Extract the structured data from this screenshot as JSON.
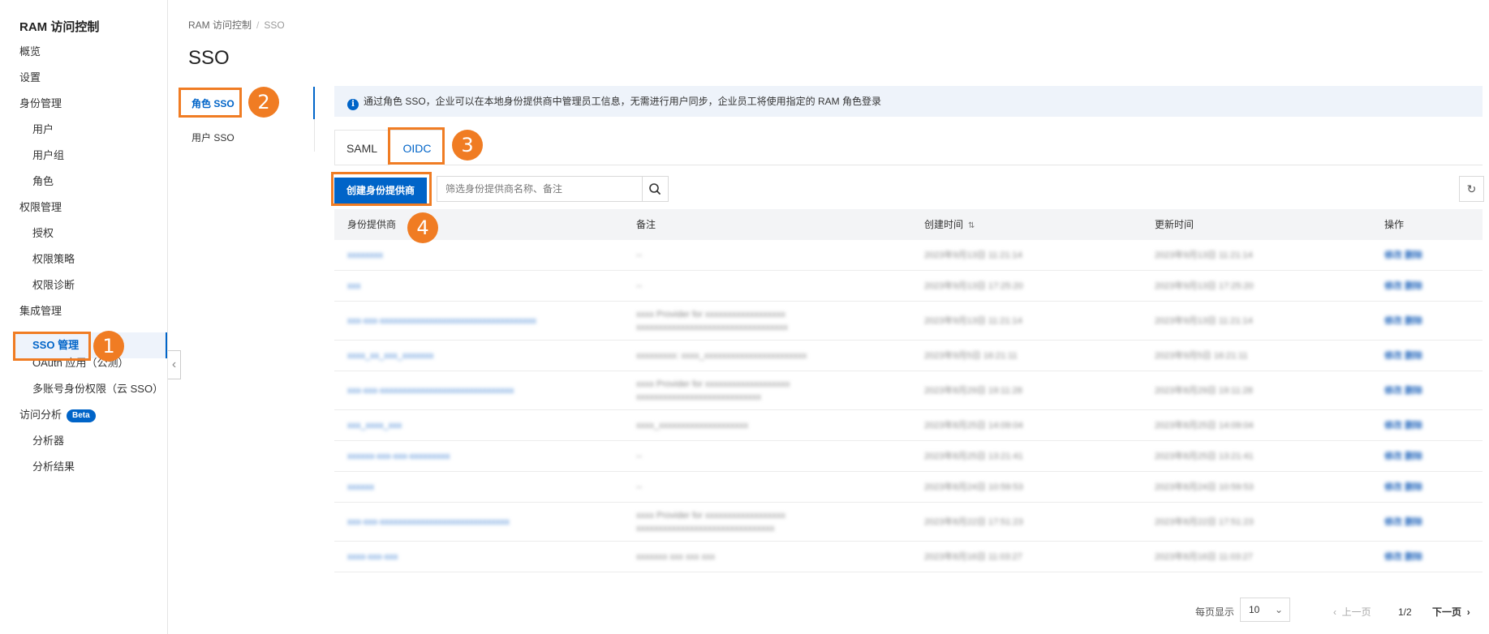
{
  "sidebar": {
    "title": "RAM 访问控制",
    "items": [
      {
        "label": "概览",
        "level": 0
      },
      {
        "label": "设置",
        "level": 0
      },
      {
        "label": "身份管理",
        "level": 0
      },
      {
        "label": "用户",
        "level": 1
      },
      {
        "label": "用户组",
        "level": 1
      },
      {
        "label": "角色",
        "level": 1
      },
      {
        "label": "权限管理",
        "level": 0
      },
      {
        "label": "授权",
        "level": 1
      },
      {
        "label": "权限策略",
        "level": 1
      },
      {
        "label": "权限诊断",
        "level": 1
      },
      {
        "label": "集成管理",
        "level": 0
      },
      {
        "label": "SSO 管理",
        "level": 1,
        "active": true
      },
      {
        "label": "OAuth 应用（公测）",
        "level": 1
      },
      {
        "label": "多账号身份权限（云 SSO）",
        "level": 1
      },
      {
        "label": "访问分析",
        "level": 0,
        "badge": "Beta"
      },
      {
        "label": "分析器",
        "level": 1
      },
      {
        "label": "分析结果",
        "level": 1
      }
    ]
  },
  "breadcrumb": {
    "root": "RAM 访问控制",
    "separator": "/",
    "current": "SSO"
  },
  "page_title": "SSO",
  "subnav": {
    "role_sso": "角色 SSO",
    "user_sso": "用户 SSO"
  },
  "info": {
    "text": "通过角色 SSO，企业可以在本地身份提供商中管理员工信息，无需进行用户同步，企业员工将使用指定的 RAM 角色登录"
  },
  "tabs": {
    "saml": "SAML",
    "oidc": "OIDC"
  },
  "toolbar": {
    "create_label": "创建身份提供商",
    "search_placeholder": "筛选身份提供商名称、备注"
  },
  "table": {
    "headers": {
      "provider": "身份提供商",
      "note": "备注",
      "created": "创建时间",
      "updated": "更新时间",
      "ops": "操作"
    },
    "rows": [
      {
        "provider": "xxxxxxxx",
        "note": [
          "--"
        ],
        "created": "2023年9月13日 11:21:14",
        "updated": "2023年9月13日 11:21:14",
        "ops": "修改 删除"
      },
      {
        "provider": "xxx",
        "note": [
          "--"
        ],
        "created": "2023年9月13日 17:25:20",
        "updated": "2023年9月13日 17:25:20",
        "ops": "修改 删除"
      },
      {
        "provider": "xxx-xxx-xxxxxxxxxxxxxxxxxxxxxxxxxxxxxxxxxxx",
        "note": [
          "xxxx Provider for xxxxxxxxxxxxxxxxxx",
          "xxxxxxxxxxxxxxxxxxxxxxxxxxxxxxxxxx"
        ],
        "created": "2023年9月13日 11:21:14",
        "updated": "2023年9月13日 11:21:14",
        "ops": "修改 删除"
      },
      {
        "provider": "xxxx_xx_xxx_xxxxxxx",
        "note": [
          "xxxxxxxxx: xxxx_xxxxxxxxxxxxxxxxxxxxxxx"
        ],
        "created": "2023年9月5日 16:21:11",
        "updated": "2023年9月5日 16:21:11",
        "ops": "修改 删除"
      },
      {
        "provider": "xxx-xxx-xxxxxxxxxxxxxxxxxxxxxxxxxxxxxx",
        "note": [
          "xxxx Provider for xxxxxxxxxxxxxxxxxxx",
          "xxxxxxxxxxxxxxxxxxxxxxxxxxxx"
        ],
        "created": "2023年8月29日 19:11:28",
        "updated": "2023年8月29日 19:11:28",
        "ops": "修改 删除"
      },
      {
        "provider": "xxx_xxxx_xxx",
        "note": [
          "xxxx_xxxxxxxxxxxxxxxxxxxx"
        ],
        "created": "2023年8月25日 14:09:04",
        "updated": "2023年8月25日 14:09:04",
        "ops": "修改 删除"
      },
      {
        "provider": "xxxxxx-xxx-xxx-xxxxxxxxx",
        "note": [
          "--"
        ],
        "created": "2023年8月25日 13:21:41",
        "updated": "2023年8月25日 13:21:41",
        "ops": "修改 删除"
      },
      {
        "provider": "xxxxxx",
        "note": [
          "--"
        ],
        "created": "2023年8月24日 10:59:53",
        "updated": "2023年8月24日 10:59:53",
        "ops": "修改 删除"
      },
      {
        "provider": "xxx-xxx-xxxxxxxxxxxxxxxxxxxxxxxxxxxxx",
        "note": [
          "xxxx Provider for xxxxxxxxxxxxxxxxxx",
          "xxxxxxxxxxxxxxxxxxxxxxxxxxxxxxx"
        ],
        "created": "2023年8月22日 17:51:23",
        "updated": "2023年8月22日 17:51:23",
        "ops": "修改 删除"
      },
      {
        "provider": "xxxx-xxx-xxx",
        "note": [
          "xxxxxxx xxx xxx xxx"
        ],
        "created": "2023年8月16日 11:03:27",
        "updated": "2023年8月16日 11:03:27",
        "ops": "修改 删除"
      }
    ]
  },
  "pagination": {
    "per_page_label": "每页显示",
    "page_size": "10",
    "prev": "上一页",
    "page": "1/2",
    "next": "下一页"
  },
  "callouts": [
    "1",
    "2",
    "3",
    "4"
  ],
  "colors": {
    "accent": "#0064c8",
    "callout": "#f07c23"
  }
}
